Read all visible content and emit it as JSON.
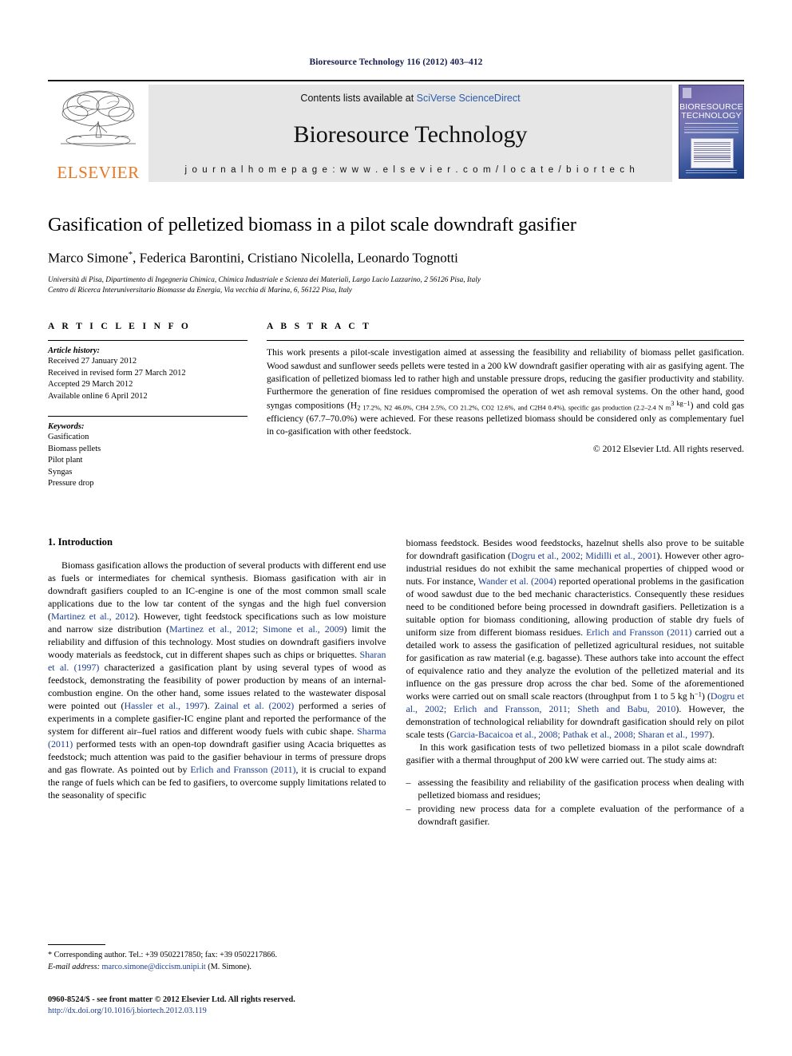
{
  "running_head": "Bioresource Technology 116 (2012) 403–412",
  "masthead": {
    "publisher": "ELSEVIER",
    "contents_prefix": "Contents lists available at ",
    "contents_link": "SciVerse ScienceDirect",
    "journal_name": "Bioresource Technology",
    "homepage": "j o u r n a l   h o m e p a g e :   w w w . e l s e v i e r . c o m / l o c a t e / b i o r t e c h",
    "cover_title_line1": "BIORESOURCE",
    "cover_title_line2": "TECHNOLOGY"
  },
  "article": {
    "title": "Gasification of pelletized biomass in a pilot scale downdraft gasifier",
    "authors": "Marco Simone",
    "authors_rest": ", Federica Barontini, Cristiano Nicolella, Leonardo Tognotti",
    "corresponding_marker": "*",
    "affiliation_1": "Università di Pisa, Dipartimento di Ingegneria Chimica, Chimica Industriale e Scienza dei Materiali, Largo Lucio Lazzarino, 2 56126 Pisa, Italy",
    "affiliation_2": "Centro di Ricerca Interuniversitario Biomasse da Energia, Via vecchia di Marina, 6, 56122 Pisa, Italy"
  },
  "article_info": {
    "heading": "A R T I C L E    I N F O",
    "history_label": "Article history:",
    "history": [
      "Received 27 January 2012",
      "Received in revised form 27 March 2012",
      "Accepted 29 March 2012",
      "Available online 6 April 2012"
    ],
    "keywords_label": "Keywords:",
    "keywords": [
      "Gasification",
      "Biomass pellets",
      "Pilot plant",
      "Syngas",
      "Pressure drop"
    ]
  },
  "abstract": {
    "heading": "A B S T R A C T",
    "part1": "This work presents a pilot-scale investigation aimed at assessing the feasibility and reliability of biomass pellet gasification. Wood sawdust and sunflower seeds pellets were tested in a 200 kW downdraft gasifier operating with air as gasifying agent. The gasification of pelletized biomass led to rather high and unstable pressure drops, reducing the gasifier productivity and stability. Furthermore the generation of fine residues compromised the operation of wet ash removal systems. On the other hand, good syngas compositions (H",
    "h2_val": "2 17.2%, N",
    "n2_val": "2 46.0%, CH",
    "ch4_val": "4 2.5%, CO 21.2%, CO",
    "co2_val": "2 12.6%, and C",
    "c2_val": "2H",
    "h4_val": "4 0.4%), specific gas production (2.2–2.4 N m",
    "m3_val": "3 kg",
    "kg_exp": "−1",
    "part_end": ") and cold gas efficiency (67.7–70.0%) were achieved. For these reasons pelletized biomass should be considered only as complementary fuel in co-gasification with other feedstock.",
    "copyright": "© 2012 Elsevier Ltd. All rights reserved."
  },
  "introduction": {
    "heading": "1. Introduction",
    "left_p1_a": "Biomass gasification allows the production of several products with different end use as fuels or intermediates for chemical synthesis. Biomass gasification with air in downdraft gasifiers coupled to an IC-engine is one of the most common small scale applications due to the low tar content of the syngas and the high fuel conversion (",
    "cite_martinez2012": "Martinez et al., 2012",
    "left_p1_b": "). However, tight feedstock specifications such as low moisture and narrow size distribution (",
    "cite_martinez_simone": "Martinez et al., 2012; Simone et al., 2009",
    "left_p1_c": ") limit the reliability and diffusion of this technology. Most studies on downdraft gasifiers involve woody materials as feedstock, cut in different shapes such as chips or briquettes. ",
    "cite_sharan": "Sharan et al. (1997)",
    "left_p1_d": " characterized a gasification plant by using several types of wood as feedstock, demonstrating the feasibility of power production by means of an internal-combustion engine. On the other hand, some issues related to the wastewater disposal were pointed out (",
    "cite_hassler": "Hassler et al., 1997",
    "left_p1_e": "). ",
    "cite_zainal": "Zainal et al. (2002)",
    "left_p1_f": " performed a series of experiments in a complete gasifier-IC engine plant and reported the performance of the system for different air–fuel ratios and different woody fuels with cubic shape. ",
    "cite_sharma": "Sharma (2011)",
    "left_p1_g": " performed tests with an open-top downdraft gasifier using Acacia briquettes as feedstock; much attention was paid to the gasifier behaviour in terms of pressure drops and gas flowrate. As pointed out by ",
    "cite_erlich": "Erlich and Fransson (2011)",
    "left_p1_h": ", it is crucial to expand the range of fuels which can be fed to gasifiers, to overcome supply limitations related to the seasonality of specific",
    "right_p1_a": "biomass feedstock. Besides wood feedstocks, hazelnut shells also prove to be suitable for downdraft gasification (",
    "cite_dogru_midilli": "Dogru et al., 2002; Midilli et al., 2001",
    "right_p1_b": "). However other agro-industrial residues do not exhibit the same mechanical properties of chipped wood or nuts. For instance, ",
    "cite_wander": "Wander et al. (2004)",
    "right_p1_c": " reported operational problems in the gasification of wood sawdust due to the bed mechanic characteristics. Consequently these residues need to be conditioned before being processed in downdraft gasifiers. Pelletization is a suitable option for biomass conditioning, allowing production of stable dry fuels of uniform size from different biomass residues. ",
    "cite_erlich2": "Erlich and Fransson (2011)",
    "right_p1_d": " carried out a detailed work to assess the gasification of pelletized agricultural residues, not suitable for gasification as raw material (e.g. bagasse). These authors take into account the effect of equivalence ratio and they analyze the evolution of the pelletized material and its influence on the gas pressure drop across the char bed. Some of the aforementioned works were carried out on small scale reactors (throughput from 1 to 5 kg h",
    "kgh_exp": "−1",
    "right_p1_e": ") (",
    "cite_dogru_erlich_sheth": "Dogru et al., 2002; Erlich and Fransson, 2011; Sheth and Babu, 2010",
    "right_p1_f": "). However, the demonstration of technological reliability for downdraft gasification should rely on pilot scale tests (",
    "cite_garcia_pathak_sharan": "Garcia-Bacaicoa et al., 2008; Pathak et al., 2008; Sharan et al., 1997",
    "right_p1_g": ").",
    "right_p2": "In this work gasification tests of two pelletized biomass in a pilot scale downdraft gasifier with a thermal throughput of 200 kW were carried out. The study aims at:",
    "aims": [
      "assessing the feasibility and reliability of the gasification process when dealing with pelletized biomass and residues;",
      "providing new process data for a complete evaluation of the performance of a downdraft gasifier."
    ]
  },
  "footnote": {
    "marker": "*",
    "corresponding": "Corresponding author. Tel.: +39 0502217850; fax: +39 0502217866.",
    "email_label": "E-mail address:",
    "email": "marco.simone@diccism.unipi.it",
    "email_suffix": " (M. Simone)."
  },
  "footer": {
    "issn_line": "0960-8524/$ - see front matter © 2012 Elsevier Ltd. All rights reserved.",
    "doi": "http://dx.doi.org/10.1016/j.biortech.2012.03.119"
  },
  "colors": {
    "elsevier_orange": "#e87722",
    "link_blue": "#1b3c8f",
    "running_head_navy": "#141b4d",
    "banner_gray": "#e6e6e6"
  }
}
